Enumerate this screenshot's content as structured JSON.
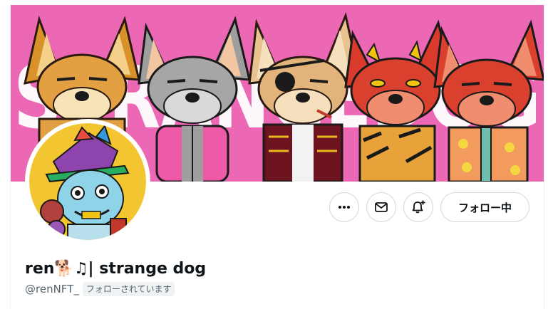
{
  "profile": {
    "display_name": "ren🐕♫| strange dog",
    "handle": "@renNFT_",
    "follows_you_label": "フォローされています",
    "banner_text": "STRANGEDOG"
  },
  "actions": {
    "more_icon": "more-horizontal-icon",
    "message_icon": "envelope-icon",
    "notify_icon": "bell-plus-icon",
    "follow_label": "フォロー中"
  },
  "colors": {
    "banner_pink": "#ec67b4",
    "text_primary": "#0f1419",
    "text_secondary": "#536471",
    "border": "#cfd9de"
  }
}
